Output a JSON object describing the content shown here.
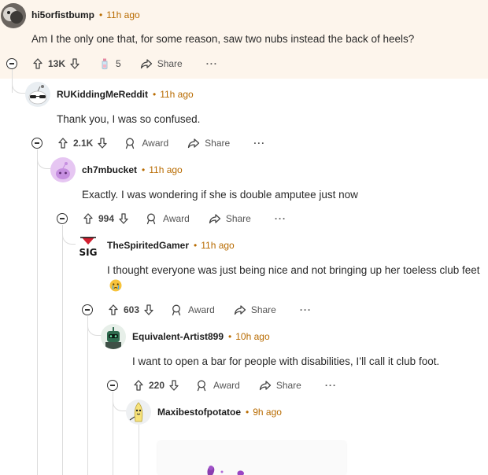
{
  "colors": {
    "highlight_bg": "#fdf5ec",
    "timestamp": "#b86b00",
    "thread_line": "#dcdcdc"
  },
  "comments": [
    {
      "author": "hi5orfistbump",
      "time": "11h ago",
      "body": "Am I the only one that, for some reason, saw two nubs instead the back of heels?",
      "votes": "13K",
      "awards": "5",
      "share_label": "Share",
      "more_label": "···",
      "avatar": "cat-photo-avatar"
    },
    {
      "author": "RUKiddingMeReddit",
      "time": "11h ago",
      "body": "Thank you, I was so confused.",
      "votes": "2.1K",
      "award_label": "Award",
      "share_label": "Share",
      "more_label": "···",
      "avatar": "snoo-sunglasses-avatar"
    },
    {
      "author": "ch7mbucket",
      "time": "11h ago",
      "body": "Exactly. I was wondering if she is double amputee just now",
      "votes": "994",
      "award_label": "Award",
      "share_label": "Share",
      "more_label": "···",
      "avatar": "purple-snoo-avatar"
    },
    {
      "author": "TheSpiritedGamer",
      "time": "11h ago",
      "body": "I thought everyone was just being nice and not bringing up her toeless club feet",
      "emoji": "crying-face",
      "votes": "603",
      "award_label": "Award",
      "share_label": "Share",
      "more_label": "···",
      "avatar": "sig-logo-avatar"
    },
    {
      "author": "Equivalent-Artist899",
      "time": "10h ago",
      "body": "I want to open a bar for people with disabilities, I’ll call it club foot.",
      "votes": "220",
      "award_label": "Award",
      "share_label": "Share",
      "more_label": "···",
      "avatar": "green-robot-avatar"
    },
    {
      "author": "Maxibestofpotatoe",
      "time": "9h ago",
      "avatar": "banana-character-avatar"
    }
  ]
}
